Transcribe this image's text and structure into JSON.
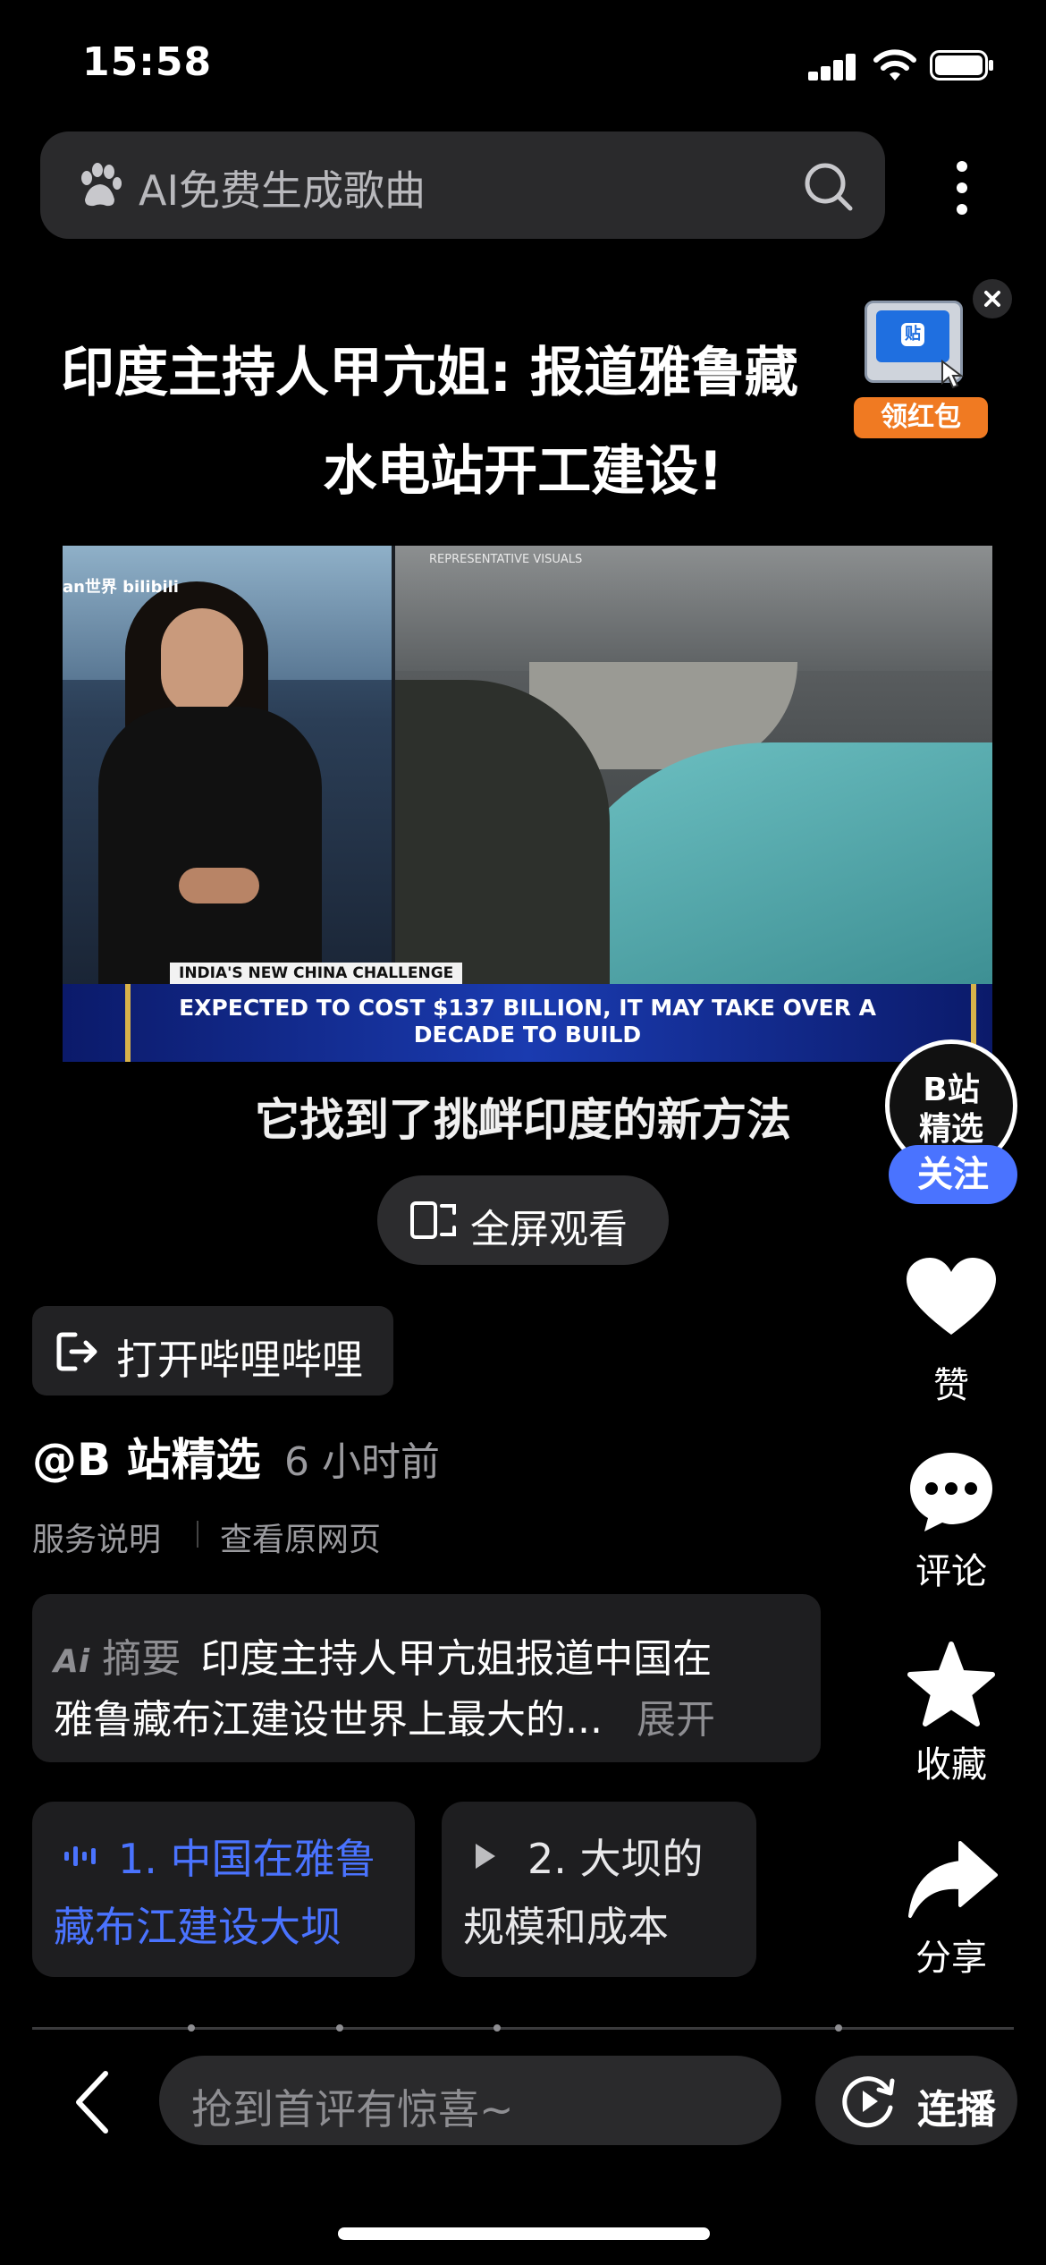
{
  "status_bar": {
    "time": "15:58"
  },
  "search": {
    "placeholder": "AI免费生成歌曲"
  },
  "promo": {
    "label": "领红包",
    "icon_text": "贴"
  },
  "video": {
    "title_line1": "印度主持人甲亢姐: 报道雅鲁藏",
    "title_line2": "水电站开工建设!",
    "watermark": "睁眼Kan世界 bilibili",
    "rep_visuals": "REPRESENTATIVE VISUALS",
    "lower_third_tag": "INDIA'S NEW CHINA CHALLENGE",
    "ticker_line1": "EXPECTED TO COST $137 BILLION, IT MAY TAKE OVER A",
    "ticker_line2": "DECADE TO BUILD",
    "subtitle": "它找到了挑衅印度的新方法",
    "fullscreen_label": "全屏观看"
  },
  "rail": {
    "avatar_text_top": "B站",
    "avatar_text_bottom": "精选",
    "follow_label": "关注",
    "like_label": "赞",
    "comment_label": "评论",
    "favorite_label": "收藏",
    "share_label": "分享"
  },
  "meta": {
    "open_app_label": "打开哔哩哔哩",
    "author": "@B 站精选",
    "time_ago": "6 小时前",
    "service_link": "服务说明",
    "original_link": "查看原网页"
  },
  "summary": {
    "ai_prefix": "Ai",
    "label": "摘要",
    "line1": "印度主持人甲亢姐报道中国在",
    "line2": "雅鲁藏布江建设世界上最大的...",
    "expand": "展开"
  },
  "chapters": [
    {
      "line1": "1. 中国在雅鲁",
      "line2": "藏布江建设大坝",
      "active": true
    },
    {
      "line1": "2. 大坝的",
      "line2": "规模和成本",
      "active": false
    }
  ],
  "bottom": {
    "comment_placeholder": "抢到首评有惊喜~",
    "autoplay_label": "连播"
  },
  "colors": {
    "accent_blue": "#4a73ff",
    "promo_orange": "#f07a22"
  }
}
